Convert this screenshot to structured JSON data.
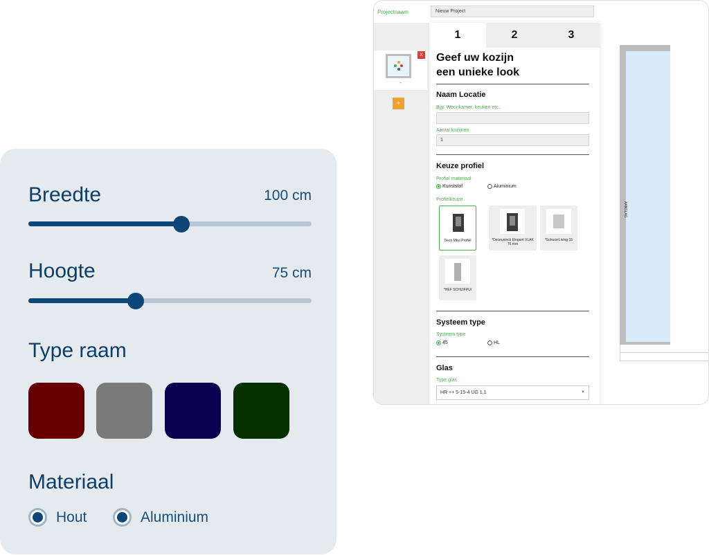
{
  "configurator": {
    "project_label": "Projectnaam",
    "project_value": "Nieuw Project",
    "window_item_label": "-",
    "delete_label": "X",
    "add_label": "+",
    "tabs": [
      "1",
      "2",
      "3"
    ],
    "heading_line1": "Geef uw kozijn",
    "heading_line2": "een unieke look",
    "location": {
      "title": "Naam Locatie",
      "name_placeholder_label": "Bijv. Woonkamer, keuken etc..",
      "count_label": "Aantal kozijnen",
      "count_value": "1"
    },
    "profile": {
      "title": "Keuze profiel",
      "material_label": "Profiel materiaal",
      "materials": [
        "Kunststof",
        "Aluminium"
      ],
      "choice_label": "Profielkeuze",
      "options": [
        "Deco Mkw Profiel",
        "*Deceuninck Elegant VLAK 76 mm",
        "*Schuco Living 15",
        "*HEF SCHUIFPUI"
      ]
    },
    "system": {
      "title": "Systeem type",
      "label": "Systeem type",
      "options": [
        "45",
        "HL"
      ]
    },
    "glass": {
      "title": "Glas",
      "label": "Type glas",
      "value": "HR ++ 5-15-4 UG 1,1"
    },
    "preview_side_label": "AANSLAG",
    "colors": {
      "green": "#4caf50",
      "red": "#e53935",
      "orange": "#f0a030",
      "glass": "#d9ebf8"
    }
  },
  "card": {
    "width": {
      "label": "Breedte",
      "value": "100 cm",
      "fraction": 0.54
    },
    "height": {
      "label": "Hoogte",
      "value": "75 cm",
      "fraction": 0.38
    },
    "type_title": "Type raam",
    "swatches": [
      "#660000",
      "#7a7a7a",
      "#0b004f",
      "#073000"
    ],
    "material_title": "Materiaal",
    "materials": [
      "Hout",
      "Aluminium"
    ],
    "accent": "#0a4778"
  }
}
